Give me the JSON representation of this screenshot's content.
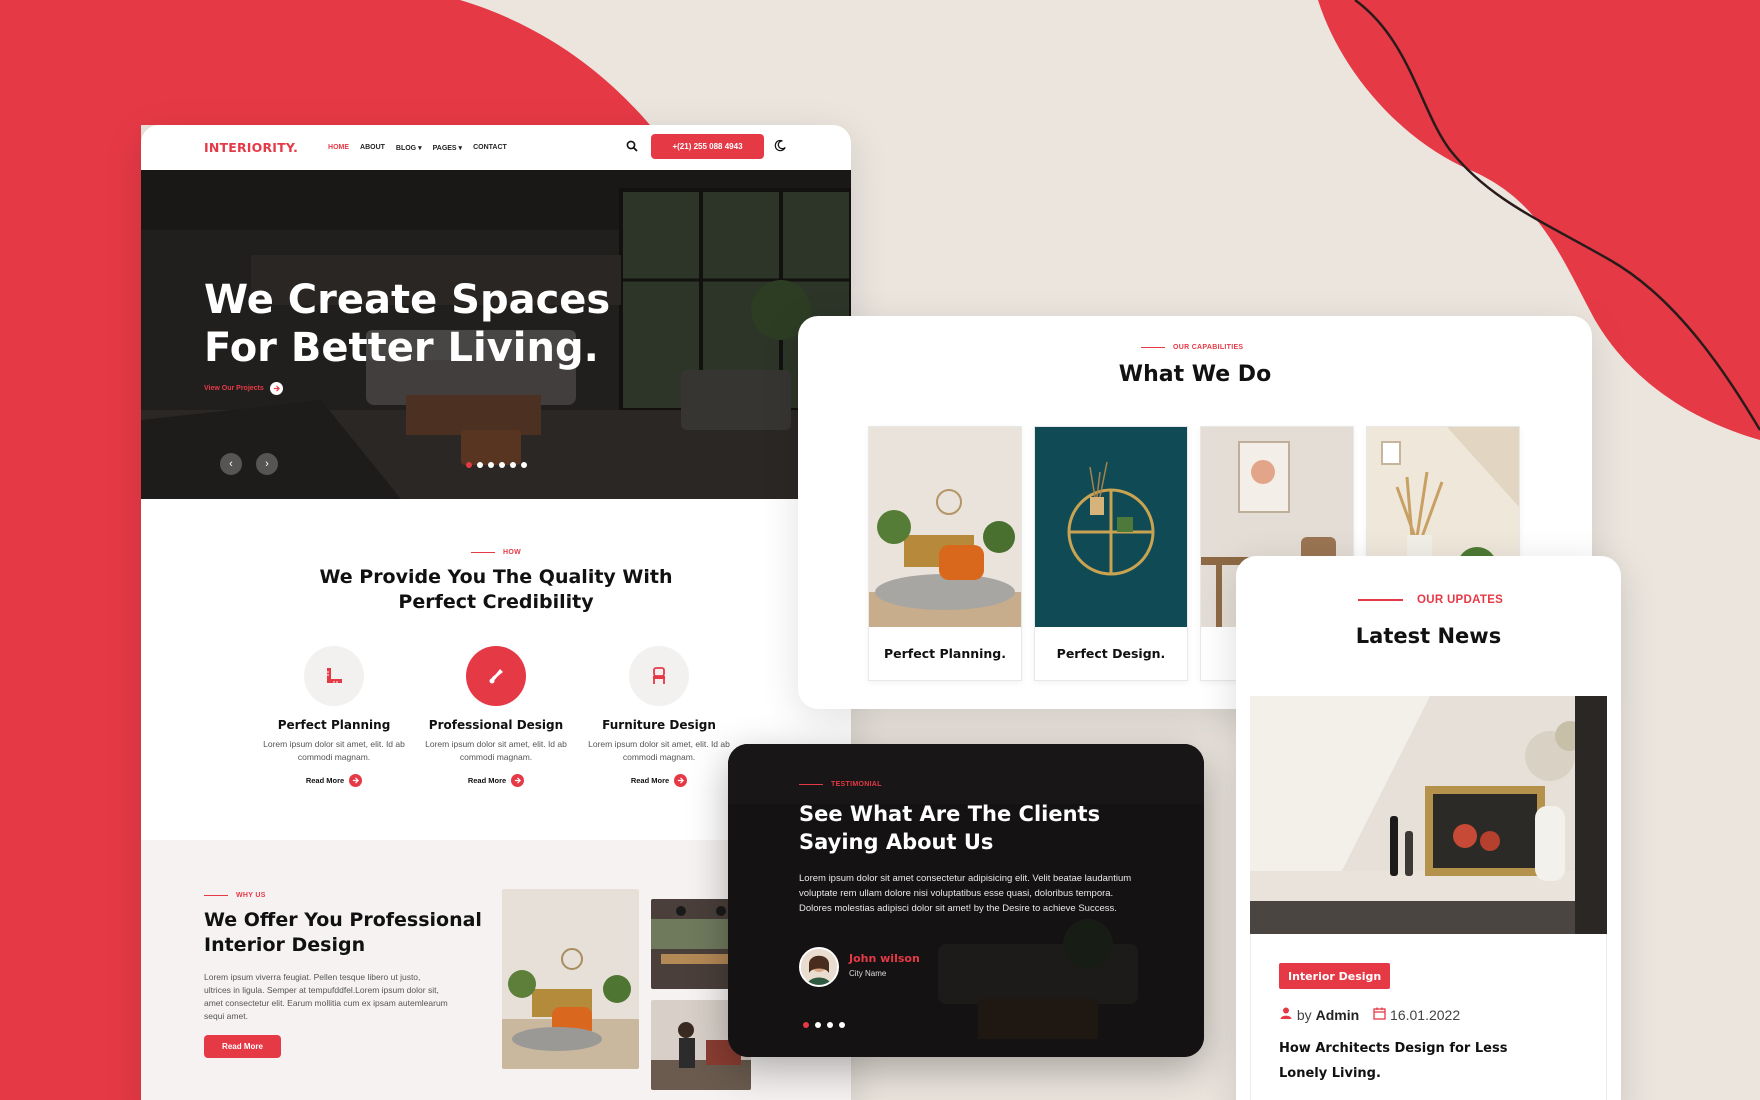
{
  "brand": {
    "accent": "#e63946",
    "dark": "#1c1b1b",
    "background": "#ebe5de"
  },
  "home": {
    "logo": "INTERIORITY.",
    "nav": [
      {
        "label": "HOME",
        "active": true
      },
      {
        "label": "ABOUT"
      },
      {
        "label": "BLOG",
        "has_dropdown": true
      },
      {
        "label": "PAGES",
        "has_dropdown": true
      },
      {
        "label": "CONTACT"
      }
    ],
    "phone": "+(21) 255 088 4943",
    "icons": {
      "search": "search-icon",
      "theme": "moon-icon"
    },
    "hero": {
      "title_line1": "We Create Spaces",
      "title_line2": "For Better Living.",
      "link": "View Our Projects",
      "slides": 6,
      "active_slide": 1
    },
    "how": {
      "kicker": "HOW",
      "title": "We Provide You The Quality With Perfect Credibility",
      "features": [
        {
          "title": "Perfect Planning",
          "text": "Lorem ipsum dolor sit amet, elit. Id ab commodi magnam.",
          "link": "Read More",
          "icon": "ruler-icon"
        },
        {
          "title": "Professional Design",
          "text": "Lorem ipsum dolor sit amet, elit. Id ab commodi magnam.",
          "link": "Read More",
          "icon": "paint-brush-icon"
        },
        {
          "title": "Furniture Design",
          "text": "Lorem ipsum dolor sit amet, elit. Id ab commodi magnam.",
          "link": "Read More",
          "icon": "chair-icon"
        }
      ]
    },
    "why": {
      "kicker": "WHY US",
      "title": "We Offer You Professional Interior Design",
      "text": "Lorem ipsum viverra feugiat. Pellen tesque libero ut justo, ultrices in ligula. Semper at tempufddfel.Lorem ipsum dolor sit, amet consectetur elit. Earum mollitia cum ex ipsam autemlearum sequi amet.",
      "button": "Read More"
    }
  },
  "capabilities": {
    "kicker": "OUR CAPABILITIES",
    "title": "What We Do",
    "cards": [
      {
        "title": "Perfect Planning."
      },
      {
        "title": "Perfect Design."
      },
      {
        "title": ""
      },
      {
        "title": ""
      }
    ]
  },
  "testimonial": {
    "kicker": "TESTIMONIAL",
    "title_line1": "See What Are The Clients",
    "title_line2": "Saying About Us",
    "quote": "Lorem ipsum dolor sit amet consectetur adipisicing elit. Velit beatae laudantium voluptate rem ullam dolore nisi voluptatibus esse quasi, doloribus tempora. Dolores molestias adipisci dolor sit amet! by the Desire to achieve Success.",
    "name": "John wilson",
    "role": "City Name",
    "slides": 4,
    "active_slide": 1
  },
  "news": {
    "kicker": "OUR UPDATES",
    "title": "Latest News",
    "tag": "Interior Design",
    "by": "by",
    "author": "Admin",
    "date": "16.01.2022",
    "post_title": "How Architects Design for Less Lonely Living."
  }
}
